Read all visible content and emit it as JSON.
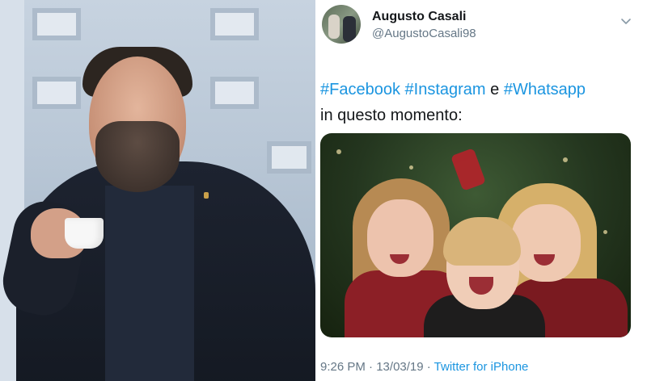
{
  "tweet": {
    "author": {
      "display_name": "Augusto Casali",
      "handle": "@AugustoCasali98"
    },
    "text": {
      "hashtag_1": "#Facebook",
      "hashtag_2": "#Instagram",
      "connector": " e ",
      "hashtag_3": "#Whatsapp",
      "line_2": "in questo momento:"
    },
    "footer": {
      "time": "9:26 PM",
      "separator_1": " · ",
      "date": "13/03/19",
      "separator_2": " · ",
      "source": "Twitter for iPhone"
    },
    "menu_icon": "chevron-down-icon"
  },
  "colors": {
    "link": "#1b95e0",
    "secondary_text": "#657786",
    "primary_text": "#14171a"
  }
}
